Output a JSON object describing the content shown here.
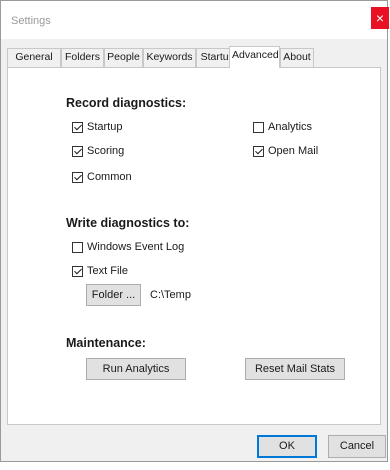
{
  "window": {
    "title": "Settings",
    "close_glyph": "×",
    "close_color": "#e81123"
  },
  "tabs": [
    {
      "label": "General",
      "active": false
    },
    {
      "label": "Folders",
      "active": false
    },
    {
      "label": "People",
      "active": false
    },
    {
      "label": "Keywords",
      "active": false
    },
    {
      "label": "Startup",
      "active": false
    },
    {
      "label": "Advanced",
      "active": true
    },
    {
      "label": "About",
      "active": false
    }
  ],
  "record": {
    "heading": "Record diagnostics:",
    "startup": {
      "label": "Startup",
      "checked": true
    },
    "scoring": {
      "label": "Scoring",
      "checked": true
    },
    "common": {
      "label": "Common",
      "checked": true
    },
    "analytics": {
      "label": "Analytics",
      "checked": false
    },
    "open_mail": {
      "label": "Open Mail",
      "checked": true
    }
  },
  "write": {
    "heading": "Write diagnostics to:",
    "event_log": {
      "label": "Windows Event Log",
      "checked": false
    },
    "text_file": {
      "label": "Text File",
      "checked": true
    },
    "folder_button": "Folder ...",
    "path": "C:\\Temp"
  },
  "maintenance": {
    "heading": "Maintenance:",
    "run_analytics": "Run Analytics",
    "reset_mail_stats": "Reset Mail Stats"
  },
  "footer": {
    "ok": "OK",
    "cancel": "Cancel",
    "accent": "#0078d7"
  }
}
